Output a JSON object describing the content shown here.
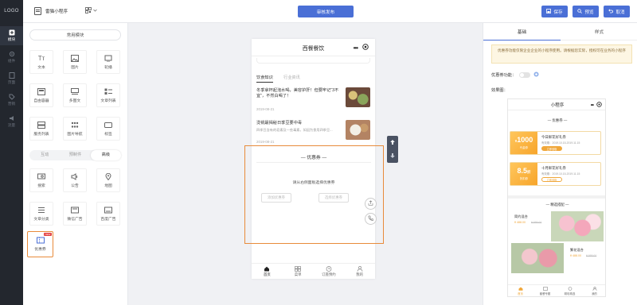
{
  "nav": {
    "logo": "LOGO",
    "items": [
      {
        "label": "模块",
        "icon": "plus-square-icon"
      },
      {
        "label": "组件",
        "icon": "gear-icon"
      },
      {
        "label": "页面",
        "icon": "page-icon"
      },
      {
        "label": "营销",
        "icon": "tag-icon"
      },
      {
        "label": "流量",
        "icon": "megaphone-icon"
      }
    ]
  },
  "topbar": {
    "app_name": "雷猫小程序",
    "publish": "审核发布",
    "save": "保存",
    "preview": "预览",
    "cancel": "取消"
  },
  "modules": {
    "common_label": "常用模块",
    "grid1": [
      {
        "label": "文本",
        "icon": "text-icon"
      },
      {
        "label": "图片",
        "icon": "image-icon"
      },
      {
        "label": "轮播",
        "icon": "carousel-icon"
      },
      {
        "label": "自由容器",
        "icon": "container-icon"
      },
      {
        "label": "多图文",
        "icon": "multi-image-text-icon"
      },
      {
        "label": "文章列表",
        "icon": "article-list-icon"
      },
      {
        "label": "服务列表",
        "icon": "service-list-icon"
      },
      {
        "label": "图片导航",
        "icon": "image-nav-icon"
      },
      {
        "label": "标签",
        "icon": "tag-icon"
      }
    ],
    "segments": [
      "互动",
      "预制件",
      "高级"
    ],
    "segment_active": 2,
    "grid2": [
      {
        "label": "搜索",
        "icon": "search-box-icon"
      },
      {
        "label": "公告",
        "icon": "speaker-icon"
      },
      {
        "label": "地图",
        "icon": "map-pin-icon"
      },
      {
        "label": "文章分类",
        "icon": "category-icon"
      },
      {
        "label": "微信广告",
        "icon": "wechat-ad-icon"
      },
      {
        "label": "百度广告",
        "icon": "baidu-ad-icon"
      },
      {
        "label": "优惠券",
        "icon": "coupon-icon",
        "badge": "NEW"
      }
    ]
  },
  "phone": {
    "title": "西餐餐饮",
    "tabs": [
      "饮食知识",
      "行业资讯"
    ],
    "news": [
      {
        "title": "冬季拿杯起泡水喝，美容护肝！但要牢记“3不宜”，不然白喝了！",
        "date": "2019-08-21"
      },
      {
        "title": "烫锅最揭秘日季豆要中毒",
        "subtitle": "四季豆含有的皂素及一些毒素，如因为食用四季豆...",
        "date": "2019-08-21"
      }
    ],
    "coupon": {
      "title": "优惠券",
      "tip": "请从右侧面板选择优惠券",
      "btn_add": "添加优惠券",
      "btn_select": "选择优惠券"
    },
    "bottom_tabs": [
      {
        "label": "首页",
        "icon": "home-icon"
      },
      {
        "label": "菜单",
        "icon": "grid-icon"
      },
      {
        "label": "订座预约",
        "icon": "clock-icon"
      },
      {
        "label": "我的",
        "icon": "user-icon"
      }
    ]
  },
  "panel": {
    "tabs": [
      "基础",
      "样式"
    ],
    "notice": "优惠券功能仅限企业企业的小程序使用。请根据您实际，授权可在业务的小程序",
    "toggle_label": "优惠券功能：",
    "effect_label": "效果图：",
    "preview": {
      "title": "小程序",
      "coupon_title": "优惠券",
      "cards": [
        {
          "amount": "1000",
          "unit": "¥",
          "sub": "代金券",
          "name": "今日鲜花好礼券",
          "date": "有效期：2019.10.15-2019.11.15",
          "btn": "立即领取"
        },
        {
          "amount": "8.5",
          "unit": "折",
          "sub": "折扣券",
          "name": "十月鲜花好礼券",
          "date": "有效期：2019.10.15-2019.11.15",
          "btn": "立即领取"
        }
      ],
      "section2": "精选搭配",
      "products": [
        {
          "name": "简约混合",
          "price": "¥ 488.00",
          "old": "¥ 999.00"
        },
        {
          "name": "繁花混合",
          "price": "¥ 488.00",
          "old": "¥ 999.00"
        }
      ],
      "tabs": [
        "首页",
        "套餐专题",
        "精彩精选",
        "我的"
      ]
    }
  },
  "colors": {
    "accent": "#4a6fd6",
    "nav_bg": "#23272e",
    "highlight": "#e88b3a",
    "coupon": "#f7a52b"
  }
}
